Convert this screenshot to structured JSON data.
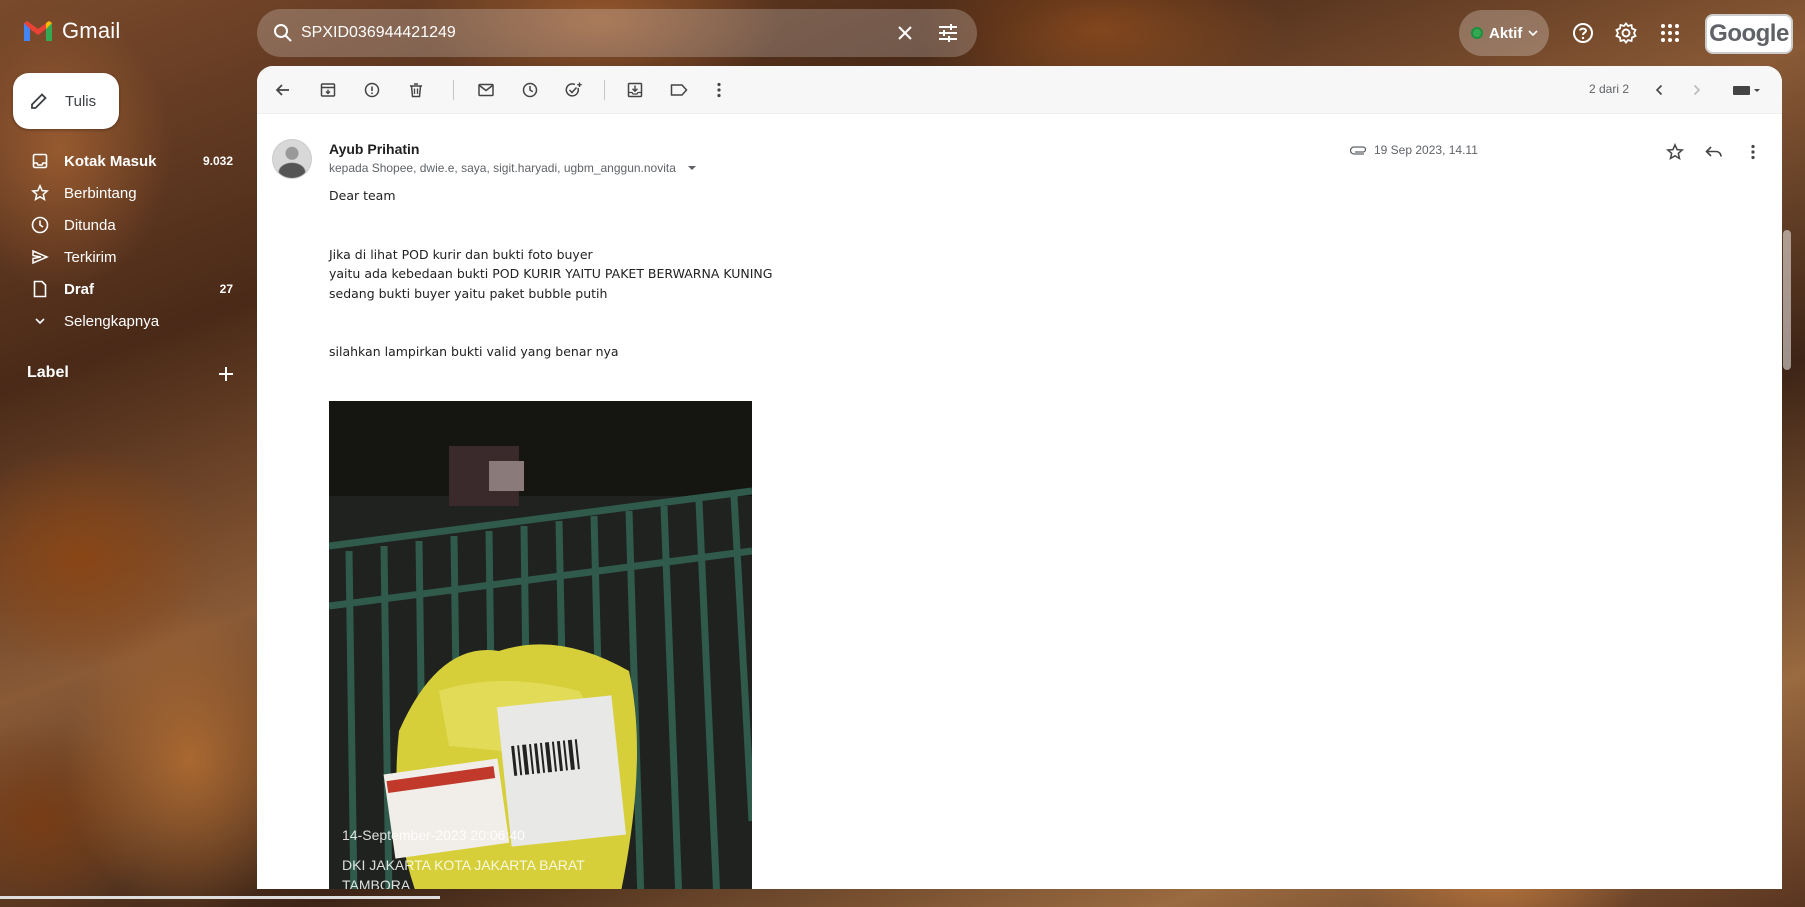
{
  "app": {
    "title": "Gmail"
  },
  "search": {
    "value": "SPXID036944421249",
    "placeholder": ""
  },
  "status": {
    "label": "Aktif",
    "color": "#34a853"
  },
  "header_badge": "Google",
  "compose": {
    "label": "Tulis"
  },
  "nav": [
    {
      "label": "Kotak Masuk",
      "count": "9.032",
      "bold": true,
      "icon": "inbox-icon"
    },
    {
      "label": "Berbintang",
      "count": "",
      "bold": false,
      "icon": "star-icon"
    },
    {
      "label": "Ditunda",
      "count": "",
      "bold": false,
      "icon": "clock-icon"
    },
    {
      "label": "Terkirim",
      "count": "",
      "bold": false,
      "icon": "send-icon"
    },
    {
      "label": "Draf",
      "count": "27",
      "bold": true,
      "icon": "draft-icon"
    },
    {
      "label": "Selengkapnya",
      "count": "",
      "bold": false,
      "icon": "chevron-down-icon"
    }
  ],
  "labels_heading": "Label",
  "toolbar": {
    "pager": "2 dari 2"
  },
  "message": {
    "sender": "Ayub Prihatin",
    "recipients": "kepada Shopee, dwie.e, saya, sigit.haryadi, ugbm_anggun.novita",
    "date": "19 Sep 2023, 14.11",
    "body": [
      "Dear team",
      "",
      "",
      "Jika di lihat POD kurir dan bukti foto buyer",
      "yaitu ada kebedaan bukti POD KURIR YAITU PAKET BERWARNA KUNING",
      "sedang bukti buyer yaitu paket bubble putih",
      "",
      "",
      "silahkan lampirkan bukti valid yang benar nya"
    ],
    "photo_caption": {
      "timestamp": "14-September-2023 20:06:40",
      "location": "DKI JAKARTA KOTA JAKARTA BARAT",
      "district": "TAMBORA"
    }
  }
}
